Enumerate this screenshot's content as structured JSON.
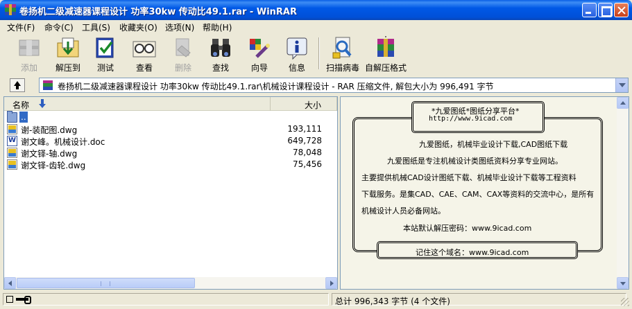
{
  "window": {
    "title": "卷扬机二级减速器课程设计 功率30kw 传动比49.1.rar - WinRAR"
  },
  "menu": [
    "文件(F)",
    "命令(C)",
    "工具(S)",
    "收藏夹(O)",
    "选项(N)",
    "帮助(H)"
  ],
  "toolbar": {
    "add": "添加",
    "extract": "解压到",
    "test": "测试",
    "view": "查看",
    "delete": "删除",
    "find": "查找",
    "wizard": "向导",
    "info": "信息",
    "virus_scan": "扫描病毒",
    "sfx": "自解压格式"
  },
  "pathbar": {
    "text": "卷扬机二级减速器课程设计 功率30kw 传动比49.1.rar\\机械设计课程设计 - RAR 压缩文件, 解包大小为 996,491 字节"
  },
  "filelist": {
    "columns": {
      "name": "名称",
      "size": "大小"
    },
    "rows": [
      {
        "name": "..",
        "size": "",
        "type": "parent"
      },
      {
        "name": "谢-装配图.dwg",
        "size": "193,111",
        "type": "dwg"
      },
      {
        "name": "谢文峰。机械设计.doc",
        "size": "649,728",
        "type": "doc"
      },
      {
        "name": "谢文铎-轴.dwg",
        "size": "78,048",
        "type": "dwg"
      },
      {
        "name": "谢文铎-齿轮.dwg",
        "size": "75,456",
        "type": "dwg"
      }
    ]
  },
  "comment": {
    "top_line1": "*九爱图纸*图纸分享平台*",
    "top_line2": "http://www.9icad.com",
    "line1": "九爱图纸，机械毕业设计下载,CAD图纸下载",
    "line2": "九爱图纸是专注机械设计类图纸资料分享专业网站。",
    "line3": "主要提供机械CAD设计图纸下载、机械毕业设计下载等工程资料",
    "line4": "下载服务。是集CAD、CAE、CAM、CAX等资料的交流中心，是所有",
    "line5": "机械设计人员必备网站。",
    "line6": "本站默认解压密码：www.9icad.com",
    "bottom": "记住这个域名：www.9icad.com"
  },
  "status": {
    "total": "总计 996,343 字节 (4 个文件)"
  }
}
